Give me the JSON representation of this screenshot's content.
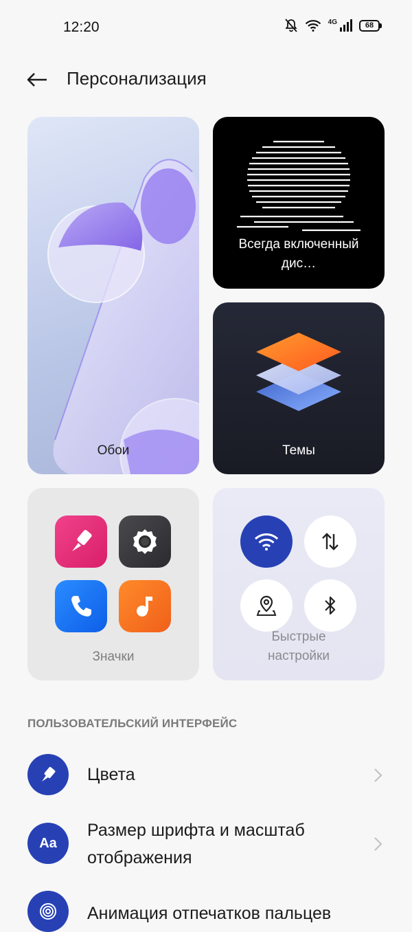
{
  "status_bar": {
    "time": "12:20",
    "network": "4G",
    "battery": "68"
  },
  "header": {
    "title": "Персонализация"
  },
  "cards": {
    "wallpaper": {
      "label": "Обои"
    },
    "aod": {
      "label": "Всегда включенный дис…"
    },
    "themes": {
      "label": "Темы"
    },
    "icons": {
      "label": "Значки"
    },
    "quick_settings": {
      "label": "Быстрые настройки"
    }
  },
  "section": {
    "title": "ПОЛЬЗОВАТЕЛЬСКИЙ ИНТЕРФЕЙС"
  },
  "list": [
    {
      "label": "Цвета",
      "icon": "brush-icon"
    },
    {
      "label": "Размер шрифта и масштаб отображения",
      "icon": "font-size-icon",
      "glyph": "Aa"
    },
    {
      "label": "Анимация отпечатков пальцев",
      "icon": "fingerprint-icon"
    }
  ],
  "colors": {
    "accent": "#2741b5",
    "background": "#f7f7f7"
  }
}
